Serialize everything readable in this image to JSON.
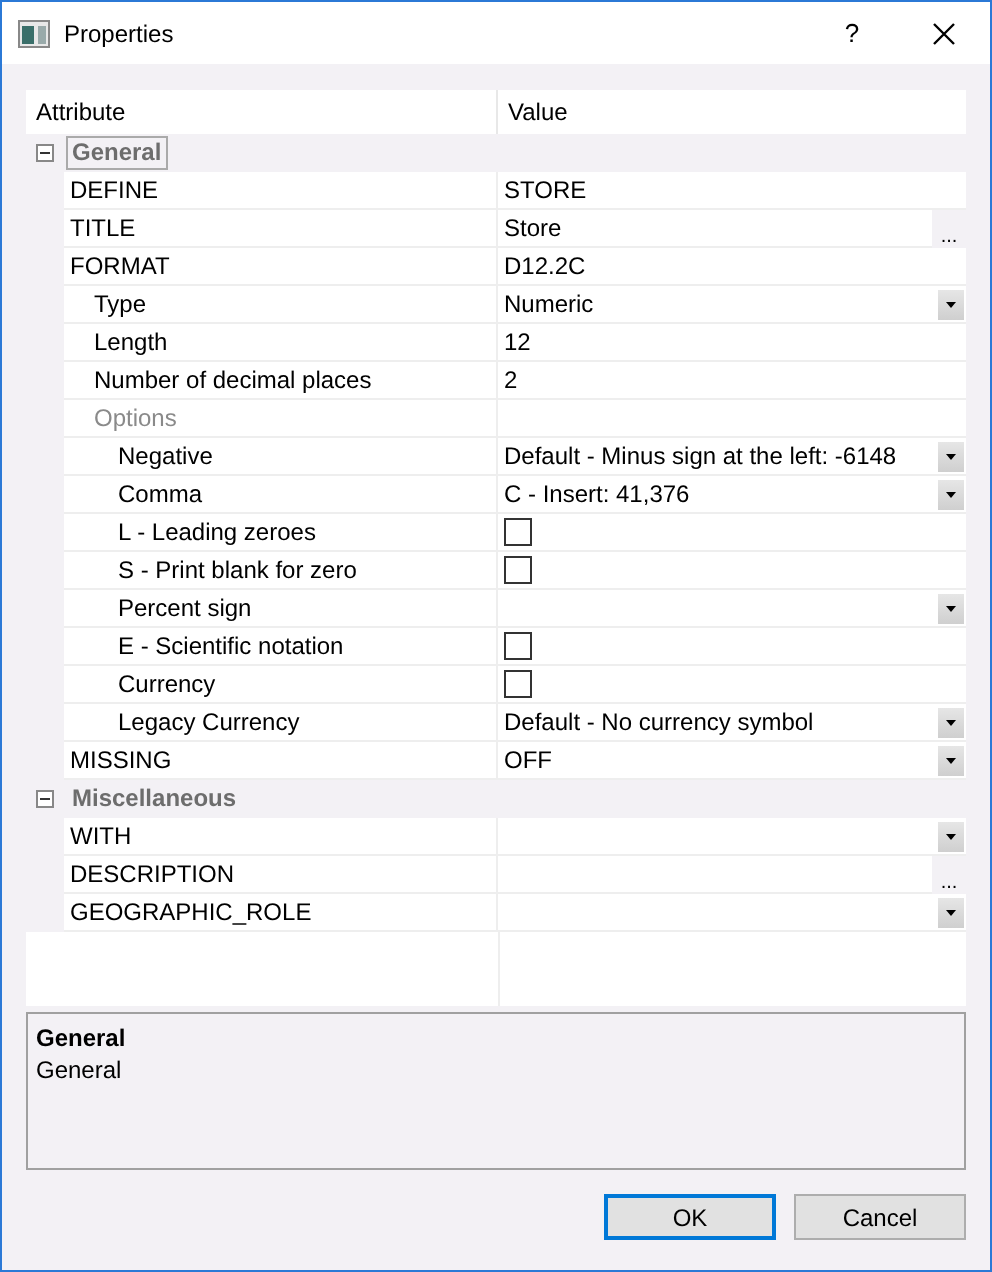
{
  "window": {
    "title": "Properties",
    "help": "?"
  },
  "grid": {
    "columns": [
      "Attribute",
      "Value"
    ],
    "groups": [
      {
        "name": "General",
        "expanded": true,
        "focused": true,
        "rows": [
          {
            "label": "DEFINE",
            "kind": "text",
            "value": "STORE"
          },
          {
            "label": "TITLE",
            "kind": "ellipsis",
            "value": "Store",
            "button": "..."
          },
          {
            "label": "FORMAT",
            "kind": "text",
            "value": "D12.2C",
            "children": [
              {
                "label": "Type",
                "kind": "dropdown",
                "value": "Numeric"
              },
              {
                "label": "Length",
                "kind": "text",
                "value": "12"
              },
              {
                "label": "Number of decimal places",
                "kind": "text",
                "value": "2"
              },
              {
                "label": "Options",
                "kind": "blank",
                "disabled": true,
                "children": [
                  {
                    "label": "Negative",
                    "kind": "dropdown",
                    "value": "Default - Minus sign at the left: -6148"
                  },
                  {
                    "label": "Comma",
                    "kind": "dropdown",
                    "value": "C - Insert: 41,376"
                  },
                  {
                    "label": "L - Leading zeroes",
                    "kind": "checkbox",
                    "checked": false
                  },
                  {
                    "label": "S - Print blank for zero",
                    "kind": "checkbox",
                    "checked": false
                  },
                  {
                    "label": "Percent sign",
                    "kind": "dropdown"
                  },
                  {
                    "label": "E - Scientific notation",
                    "kind": "checkbox",
                    "checked": false
                  },
                  {
                    "label": "Currency",
                    "kind": "checkbox",
                    "checked": false
                  },
                  {
                    "label": "Legacy Currency",
                    "kind": "dropdown",
                    "value": "Default - No currency symbol"
                  }
                ]
              }
            ]
          },
          {
            "label": "MISSING",
            "kind": "dropdown",
            "value": "OFF"
          }
        ]
      },
      {
        "name": "Miscellaneous",
        "expanded": true,
        "focused": false,
        "rows": [
          {
            "label": "WITH",
            "kind": "dropdown"
          },
          {
            "label": "DESCRIPTION",
            "kind": "ellipsis",
            "button": "..."
          },
          {
            "label": "GEOGRAPHIC_ROLE",
            "kind": "dropdown"
          }
        ]
      }
    ]
  },
  "description": {
    "title": "General",
    "text": "General"
  },
  "buttons": [
    {
      "label": "OK",
      "default": true
    },
    {
      "label": "Cancel",
      "default": false
    }
  ]
}
